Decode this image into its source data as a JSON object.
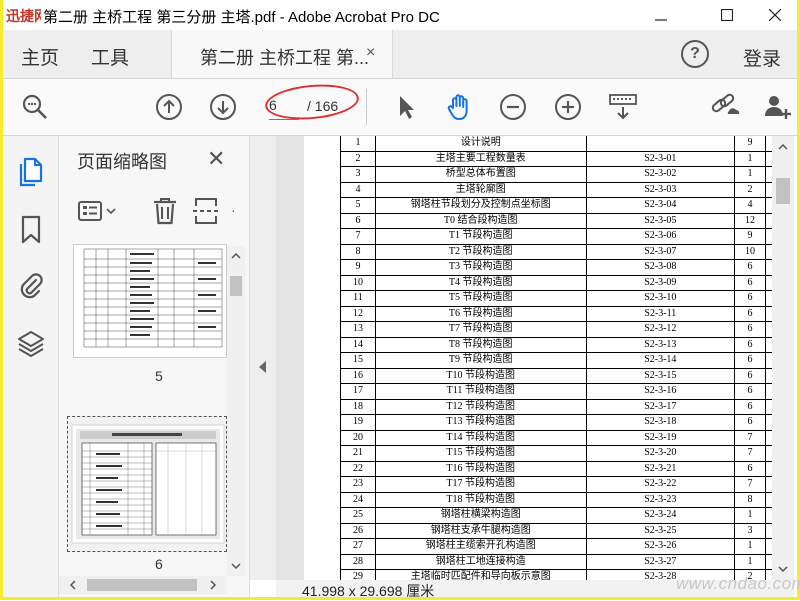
{
  "window": {
    "title": "第二册 主桥工程 第三分册 主塔.pdf - Adobe Acrobat Pro DC",
    "logo_text": "迅捷网",
    "controls": [
      "—",
      "☐",
      "✕"
    ]
  },
  "tabbar": {
    "home": "主页",
    "tools": "工具",
    "doc_tab": "第二册 主桥工程 第...",
    "close": "×",
    "help": "?",
    "login": "登录"
  },
  "toolbar": {
    "page_value": "6",
    "page_count": "/ 166",
    "icons": [
      "zoom-search-icon",
      "page-up-icon",
      "page-down-icon",
      "select-arrow-icon",
      "hand-tool-icon",
      "zoom-out-icon",
      "zoom-in-icon",
      "keyboard-scroll-icon",
      "share-link-icon",
      "add-user-icon"
    ]
  },
  "thumbnail_panel": {
    "title": "页面缩略图",
    "close": "✕",
    "thumbs": [
      {
        "label": "5"
      },
      {
        "label": "6"
      }
    ]
  },
  "document": {
    "rows": [
      {
        "no": "1",
        "name": "设计说明",
        "dwg": "",
        "pages": "9"
      },
      {
        "no": "2",
        "name": "主塔主要工程数量表",
        "dwg": "S2-3-01",
        "pages": "1"
      },
      {
        "no": "3",
        "name": "桥型总体布置图",
        "dwg": "S2-3-02",
        "pages": "1"
      },
      {
        "no": "4",
        "name": "主塔轮廓图",
        "dwg": "S2-3-03",
        "pages": "2"
      },
      {
        "no": "5",
        "name": "钢塔柱节段划分及控制点坐标图",
        "dwg": "S2-3-04",
        "pages": "4"
      },
      {
        "no": "6",
        "name": "T0 结合段构造图",
        "dwg": "S2-3-05",
        "pages": "12"
      },
      {
        "no": "7",
        "name": "T1 节段构造图",
        "dwg": "S2-3-06",
        "pages": "9"
      },
      {
        "no": "8",
        "name": "T2 节段构造图",
        "dwg": "S2-3-07",
        "pages": "10"
      },
      {
        "no": "9",
        "name": "T3 节段构造图",
        "dwg": "S2-3-08",
        "pages": "6"
      },
      {
        "no": "10",
        "name": "T4 节段构造图",
        "dwg": "S2-3-09",
        "pages": "6"
      },
      {
        "no": "11",
        "name": "T5 节段构造图",
        "dwg": "S2-3-10",
        "pages": "6"
      },
      {
        "no": "12",
        "name": "T6 节段构造图",
        "dwg": "S2-3-11",
        "pages": "6"
      },
      {
        "no": "13",
        "name": "T7 节段构造图",
        "dwg": "S2-3-12",
        "pages": "6"
      },
      {
        "no": "14",
        "name": "T8 节段构造图",
        "dwg": "S2-3-13",
        "pages": "6"
      },
      {
        "no": "15",
        "name": "T9 节段构造图",
        "dwg": "S2-3-14",
        "pages": "6"
      },
      {
        "no": "16",
        "name": "T10 节段构造图",
        "dwg": "S2-3-15",
        "pages": "6"
      },
      {
        "no": "17",
        "name": "T11 节段构造图",
        "dwg": "S2-3-16",
        "pages": "6"
      },
      {
        "no": "18",
        "name": "T12 节段构造图",
        "dwg": "S2-3-17",
        "pages": "6"
      },
      {
        "no": "19",
        "name": "T13 节段构造图",
        "dwg": "S2-3-18",
        "pages": "6"
      },
      {
        "no": "20",
        "name": "T14 节段构造图",
        "dwg": "S2-3-19",
        "pages": "7"
      },
      {
        "no": "21",
        "name": "T15 节段构造图",
        "dwg": "S2-3-20",
        "pages": "7"
      },
      {
        "no": "22",
        "name": "T16 节段构造图",
        "dwg": "S2-3-21",
        "pages": "6"
      },
      {
        "no": "23",
        "name": "T17 节段构造图",
        "dwg": "S2-3-22",
        "pages": "7"
      },
      {
        "no": "24",
        "name": "T18 节段构造图",
        "dwg": "S2-3-23",
        "pages": "8"
      },
      {
        "no": "25",
        "name": "钢塔柱横梁构造图",
        "dwg": "S2-3-24",
        "pages": "1"
      },
      {
        "no": "26",
        "name": "钢塔柱支承牛腿构造图",
        "dwg": "S2-3-25",
        "pages": "3"
      },
      {
        "no": "27",
        "name": "钢塔柱主缆索开孔构造图",
        "dwg": "S2-3-26",
        "pages": "1"
      },
      {
        "no": "28",
        "name": "钢塔柱工地连接构造",
        "dwg": "S2-3-27",
        "pages": "1"
      },
      {
        "no": "29",
        "name": "主塔临时匹配件和导向板示意图",
        "dwg": "S2-3-28",
        "pages": "2"
      }
    ]
  },
  "status": {
    "dimensions": "41.998 x 29.698 厘米"
  },
  "watermark": "www.cndao.com",
  "colors": {
    "accent": "#1473e6",
    "frame": "#f4ec2c",
    "annotation": "#e03030"
  }
}
